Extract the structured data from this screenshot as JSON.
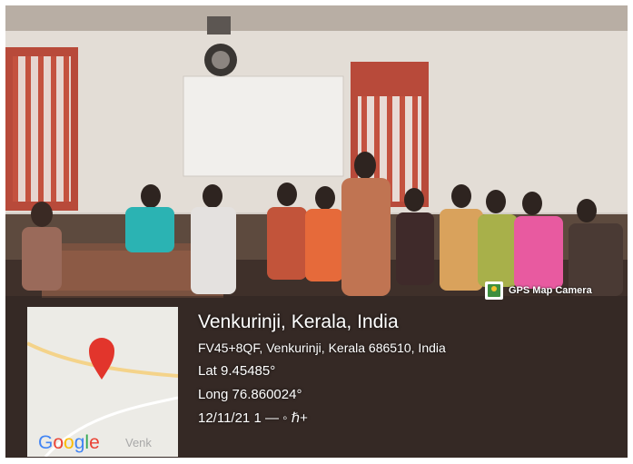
{
  "overlay": {
    "location_title": "Venkurinji, Kerala, India",
    "address": "FV45+8QF, Venkurinji, Kerala 686510, India",
    "latitude": "Lat 9.45485°",
    "longitude": "Long 76.860024°",
    "datetime": "12/11/21 1 — ◦ ℏ+"
  },
  "gps_badge": {
    "label": "GPS Map Camera",
    "icon": "gps-map-camera-icon"
  },
  "map": {
    "brand": "Google",
    "place_label": "Venk",
    "pin_icon": "map-pin-icon",
    "brand_colors": [
      "#4285f4",
      "#ea4335",
      "#fbbc05",
      "#4285f4",
      "#34a853",
      "#ea4335"
    ],
    "pin_color": "#e2352c"
  }
}
